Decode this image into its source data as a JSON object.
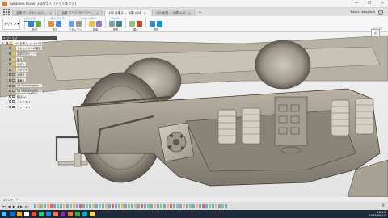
{
  "window": {
    "title": "Autodesk Fusion 360 (ストリテクトキング)",
    "controls": [
      "—",
      "☐",
      "✕"
    ]
  },
  "tabs": [
    {
      "label": "台車 ディスカレル(ミ...",
      "active": false
    },
    {
      "label": "台車 グーフ (サーマー...",
      "active": false
    },
    {
      "label": "150 台車ス ... 台車 v.24",
      "active": true
    },
    {
      "label": "150 台車 ... 台車 v.24",
      "active": false
    }
  ],
  "user": {
    "name": "Tatsuo Kobayashi"
  },
  "toolbar": {
    "workspace": "デザイン",
    "ribbon_tabs": [
      "ソリッド",
      "サーフェス",
      "シートメタル",
      "ツール"
    ],
    "groups": [
      {
        "label": "作成",
        "colors": [
          "#3a7bd5",
          "#6aa84f"
        ]
      },
      {
        "label": "修正",
        "colors": [
          "#e69138",
          "#4a86e8"
        ]
      },
      {
        "label": "アセンブリ",
        "colors": [
          "#6d9eeb",
          "#999999"
        ]
      },
      {
        "label": "構築",
        "colors": [
          "#f1c232",
          "#8e7cc3"
        ]
      },
      {
        "label": "検査",
        "colors": [
          "#76a5af",
          "#45818e"
        ]
      },
      {
        "label": "挿入",
        "colors": [
          "#93c47d",
          "#cc4125"
        ]
      },
      {
        "label": "選択",
        "colors": [
          "#3d85c6",
          "#0696d7"
        ]
      }
    ]
  },
  "browser": {
    "header": "ブラウザ",
    "rows": [
      {
        "label": "150 台車ス...(...) v.24",
        "kind": "root"
      },
      {
        "label": "ドキュメントの設定",
        "kind": "folder"
      },
      {
        "label": "名前付きビュー",
        "kind": "folder"
      },
      {
        "label": "原点",
        "kind": "folder"
      },
      {
        "label": "ボディ",
        "kind": "folder"
      },
      {
        "label": "スケッチ",
        "kind": "folder"
      },
      {
        "label": "台枠:1",
        "kind": "comp"
      },
      {
        "label": "車輪:1",
        "kind": "comp"
      },
      {
        "label": "V6 Seesaw gear:1",
        "kind": "comp"
      },
      {
        "label": "V6 Seesaw gear:2",
        "kind": "comp"
      },
      {
        "label": "軸ばね:1",
        "kind": "comp"
      },
      {
        "label": "ブレーキ:1",
        "kind": "comp"
      },
      {
        "label": "ブレーキ:2",
        "kind": "comp"
      }
    ]
  },
  "viewcube": {
    "face": "右"
  },
  "comments": {
    "label": "コメント"
  },
  "timeline": {
    "buttons": [
      "⏮",
      "◀",
      "▶",
      "▶▶",
      "⏭"
    ],
    "feature_colors": [
      "#6fa8dc",
      "#f6b26b",
      "#93c47d",
      "#6fa8dc",
      "#f6b26b",
      "#e06666",
      "#6fa8dc",
      "#93c47d",
      "#6fa8dc",
      "#f6b26b",
      "#6fa8dc",
      "#93c47d",
      "#f6b26b",
      "#6fa8dc",
      "#e06666",
      "#6fa8dc",
      "#93c47d",
      "#6fa8dc",
      "#f6b26b",
      "#6fa8dc",
      "#93c47d",
      "#6fa8dc",
      "#f6b26b",
      "#6fa8dc",
      "#e06666",
      "#6fa8dc",
      "#93c47d",
      "#f6b26b",
      "#6fa8dc",
      "#93c47d",
      "#6fa8dc",
      "#f6b26b",
      "#6fa8dc",
      "#e06666",
      "#6fa8dc",
      "#93c47d",
      "#6fa8dc",
      "#f6b26b",
      "#6fa8dc",
      "#93c47d",
      "#6fa8dc",
      "#f6b26b",
      "#e06666",
      "#6fa8dc",
      "#93c47d",
      "#6fa8dc",
      "#f6b26b",
      "#6fa8dc",
      "#93c47d",
      "#6fa8dc",
      "#f6b26b",
      "#6fa8dc",
      "#e06666",
      "#6fa8dc",
      "#93c47d",
      "#6fa8dc",
      "#f6b26b",
      "#6fa8dc",
      "#93c47d",
      "#6fa8dc"
    ]
  },
  "taskbar": {
    "icon_colors": [
      "#0078d4",
      "#f9a825",
      "#ffffff",
      "#e74c3c",
      "#2ecc71",
      "#1e88e5",
      "#ff7043",
      "#8e24aa",
      "#e8773a",
      "#43a047",
      "#00acc1",
      "#fdd835"
    ],
    "time": "16:43",
    "date": "2019/05/12"
  }
}
